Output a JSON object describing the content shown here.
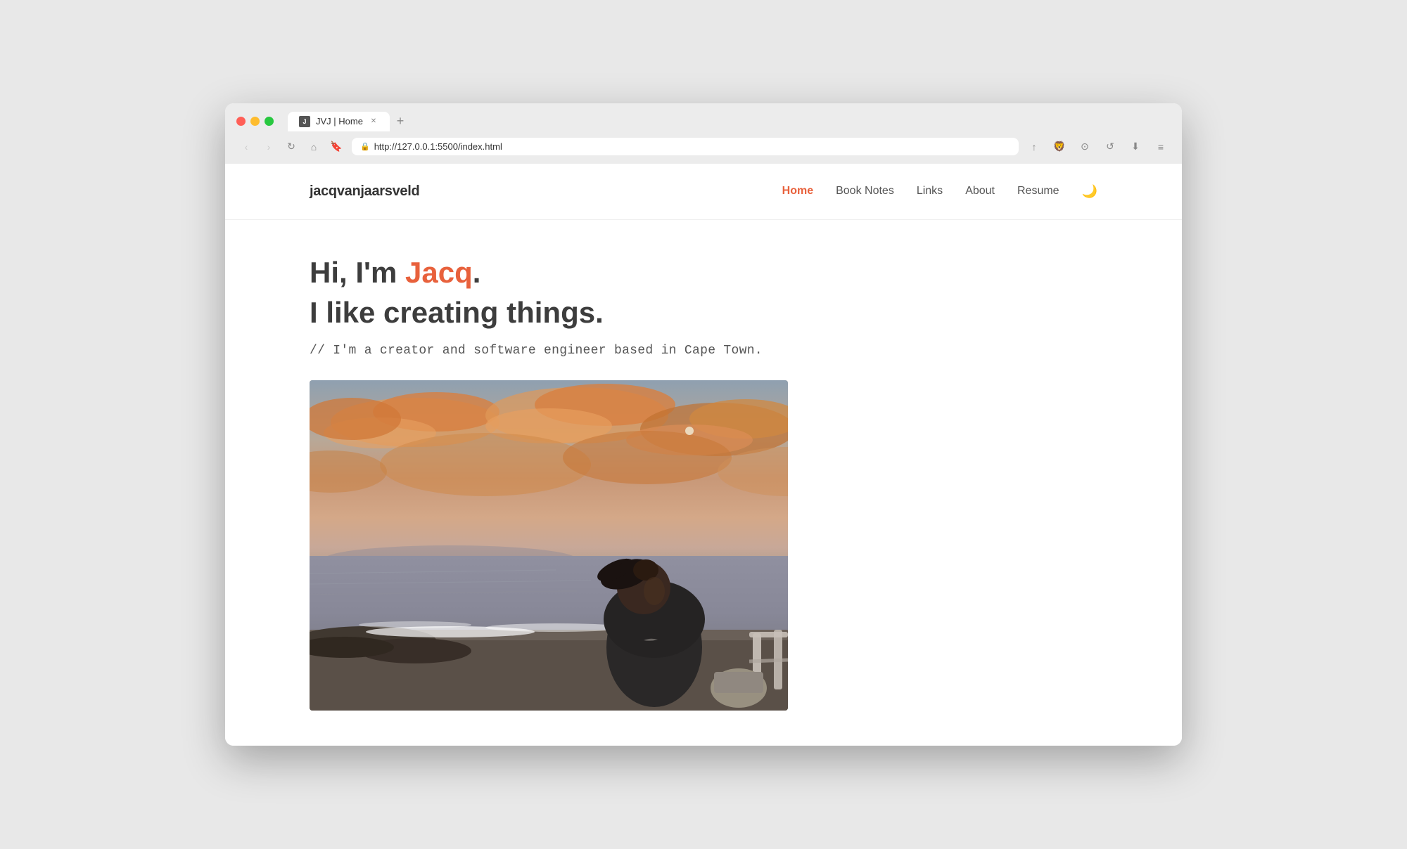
{
  "browser": {
    "tab_title": "JVJ | Home",
    "url": "http://127.0.0.1:5500/index.html",
    "new_tab_label": "+",
    "favicon_text": "J"
  },
  "nav_buttons": {
    "back": "‹",
    "forward": "›",
    "refresh": "↻",
    "home": "⌂",
    "bookmark": "🔖"
  },
  "toolbar": {
    "share": "↑",
    "brave": "🦁",
    "camera": "⊙",
    "sync": "↺",
    "download": "⬇",
    "menu": "≡"
  },
  "site": {
    "logo": "jacqvanjaarsveld",
    "nav": {
      "home": "Home",
      "book_notes": "Book Notes",
      "links": "Links",
      "about": "About",
      "resume": "Resume"
    },
    "hero": {
      "greeting": "Hi, I'm ",
      "name": "Jacq",
      "period": ".",
      "tagline": "I like creating things.",
      "subtitle": "// I'm a creator and software engineer based in Cape Town."
    }
  }
}
